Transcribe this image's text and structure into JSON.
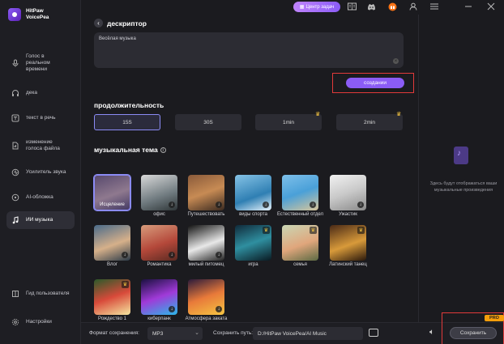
{
  "app": {
    "name": "HitPaw VoicePea"
  },
  "topbar": {
    "center_label": "Центр задач",
    "icons": [
      "book-icon",
      "discord-icon",
      "gift-icon",
      "user-icon",
      "menu-icon",
      "minimize-icon",
      "close-icon"
    ]
  },
  "sidebar": {
    "items": [
      {
        "label": "Голос в реальном времени",
        "icon": "mic-icon"
      },
      {
        "label": "дека",
        "icon": "headphones-icon"
      },
      {
        "label": "текст в речь",
        "icon": "text-icon"
      },
      {
        "label": "изменение голоса файла",
        "icon": "file-audio-icon"
      },
      {
        "label": "Усилитель звука",
        "icon": "amplifier-icon"
      },
      {
        "label": "AI-обложка",
        "icon": "ai-cover-icon"
      },
      {
        "label": "ИИ музыка",
        "icon": "music-note-icon",
        "active": true
      }
    ],
    "bottom": [
      {
        "label": "Гид пользователя",
        "icon": "book-icon"
      },
      {
        "label": "Настройки",
        "icon": "gear-icon"
      }
    ]
  },
  "main": {
    "descriptor_title": "дескриптор",
    "descriptor_value": "Весёлая музыка",
    "create_label": "создании",
    "duration_title": "продолжительность",
    "durations": [
      {
        "label": "15S",
        "selected": true,
        "pro": false
      },
      {
        "label": "30S",
        "selected": false,
        "pro": false
      },
      {
        "label": "1min",
        "selected": false,
        "pro": true
      },
      {
        "label": "2min",
        "selected": false,
        "pro": true
      }
    ],
    "theme_title": "музыкальная тема",
    "themes": [
      {
        "label": "Исцеление",
        "selected": true,
        "badge": "none"
      },
      {
        "label": "офис",
        "badge": "download"
      },
      {
        "label": "Путешествовать",
        "badge": "download"
      },
      {
        "label": "виды спорта",
        "badge": "download"
      },
      {
        "label": "Естественный отдел",
        "badge": "download"
      },
      {
        "label": "Ужастик",
        "badge": "download"
      },
      {
        "label": "Влог",
        "badge": "download"
      },
      {
        "label": "Романтика",
        "badge": "download"
      },
      {
        "label": "милый питомец",
        "badge": "download"
      },
      {
        "label": "игра",
        "badge": "pro"
      },
      {
        "label": "семья",
        "badge": "pro"
      },
      {
        "label": "Латинский танец",
        "badge": "pro"
      },
      {
        "label": "Рождество 1",
        "badge": "pro"
      },
      {
        "label": "киберпанк",
        "badge": "download"
      },
      {
        "label": "Атмосфера заката",
        "badge": "download"
      }
    ]
  },
  "right_panel": {
    "placeholder_text": "Здесь будут отображаться ваши музыкальные произведения"
  },
  "bottombar": {
    "format_label": "Формат сохранения:",
    "format_value": "MP3",
    "path_label": "Сохранить путь:",
    "path_value": "D:/HitPaw VoicePea/AI Music",
    "convert_label": "Сохранить",
    "pro_label": "PRO"
  },
  "colors": {
    "accent": "#8b5cf6",
    "highlight_border": "#e23a3a",
    "background": "#1b1b1f"
  }
}
